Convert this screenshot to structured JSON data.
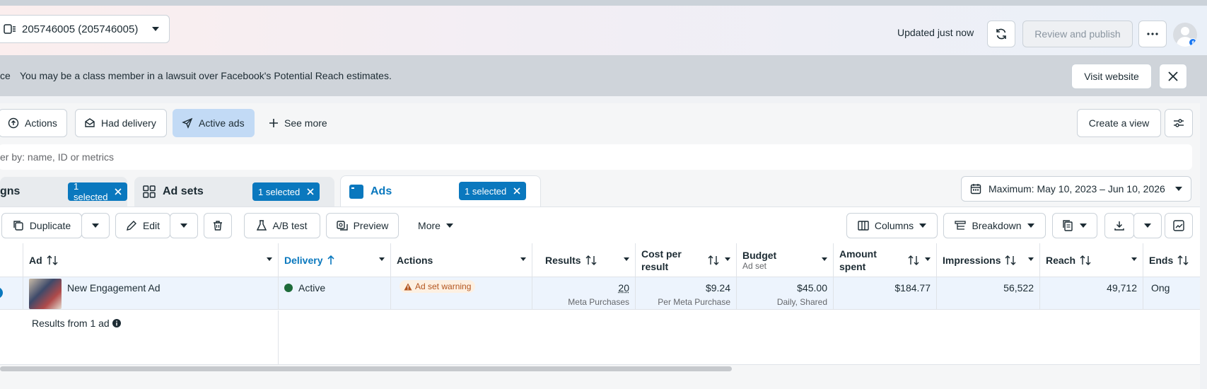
{
  "header": {
    "account_label": "205746005 (205746005)",
    "updated_text": "Updated just now",
    "review_publish_label": "Review and publish",
    "more_icon": "ellipsis-icon",
    "refresh_icon": "refresh-icon"
  },
  "banner": {
    "prefix": "ce",
    "message": "You may be a class member in a lawsuit over Facebook's Potential Reach estimates.",
    "visit_label": "Visit website"
  },
  "filters": {
    "chips": [
      {
        "label": "Actions",
        "icon": "upload-icon"
      },
      {
        "label": "Had delivery",
        "icon": "mail-icon"
      },
      {
        "label": "Active ads",
        "icon": "send-icon"
      },
      {
        "label": "See more",
        "icon": "plus-icon"
      }
    ],
    "create_view_label": "Create a view",
    "search_placeholder": "er by: name, ID or metrics"
  },
  "tabs": {
    "campaigns": {
      "label": "gns",
      "selected": "1 selected"
    },
    "adsets": {
      "label": "Ad sets",
      "selected": "1 selected"
    },
    "ads": {
      "label": "Ads",
      "selected": "1 selected"
    },
    "date_range": "Maximum: May 10, 2023 – Jun 10, 2026"
  },
  "toolbar": {
    "duplicate": "Duplicate",
    "edit": "Edit",
    "ab_test": "A/B test",
    "preview": "Preview",
    "more": "More",
    "columns": "Columns",
    "breakdown": "Breakdown"
  },
  "table": {
    "columns": {
      "ad": "Ad",
      "delivery": "Delivery",
      "actions": "Actions",
      "results": "Results",
      "cost_per_result": "Cost per result",
      "budget": "Budget",
      "budget_sub": "Ad set",
      "amount_spent": "Amount spent",
      "impressions": "Impressions",
      "reach": "Reach",
      "ends": "Ends"
    },
    "row": {
      "ad_name": "New Engagement Ad",
      "delivery": "Active",
      "actions_badge": "Ad set warning",
      "results": "20",
      "results_sub": "Meta Purchases",
      "cost_per_result": "$9.24",
      "cost_sub": "Per Meta Purchase",
      "budget": "$45.00",
      "budget_sub": "Daily, Shared",
      "amount_spent": "$184.77",
      "impressions": "56,522",
      "reach": "49,712",
      "ends": "Ong"
    },
    "footer": "Results from 1 ad"
  },
  "colors": {
    "accent": "#0a78be",
    "active_chip": "#c2daf5",
    "active_dot": "#1e6b3a",
    "warning": "#b3541e"
  }
}
